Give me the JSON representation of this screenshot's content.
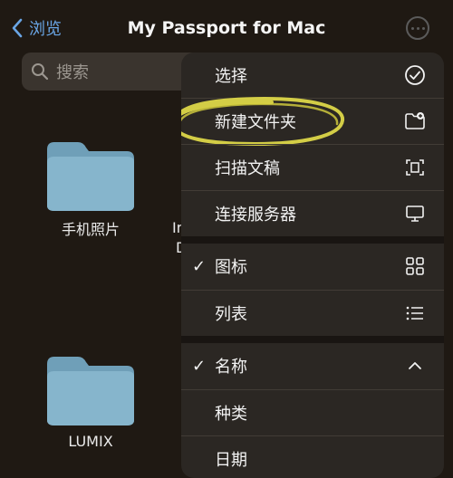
{
  "header": {
    "back_label": "浏览",
    "title": "My Passport for Mac"
  },
  "search": {
    "placeholder": "搜索"
  },
  "folders": [
    {
      "name": "手机照片"
    },
    {
      "name": "LUMIX"
    }
  ],
  "partial_labels": [
    "In",
    "D"
  ],
  "menu": {
    "items": [
      {
        "label": "选择",
        "icon": "checkmark-circle-icon",
        "checked": false
      },
      {
        "label": "新建文件夹",
        "icon": "new-folder-icon",
        "checked": false,
        "highlighted": true
      },
      {
        "label": "扫描文稿",
        "icon": "scan-document-icon",
        "checked": false
      },
      {
        "label": "连接服务器",
        "icon": "monitor-icon",
        "checked": false
      },
      {
        "label": "图标",
        "icon": "grid-icon",
        "checked": true,
        "check_mark": "✓"
      },
      {
        "label": "列表",
        "icon": "list-icon",
        "checked": false
      },
      {
        "label": "名称",
        "icon": "chevron-up-icon",
        "checked": true,
        "check_mark": "✓"
      },
      {
        "label": "种类",
        "checked": false
      },
      {
        "label": "日期",
        "checked": false
      }
    ]
  },
  "colors": {
    "background": "#1f1913",
    "menu": "#2b2723",
    "accent": "#6aa6e6",
    "folder": "#7fb0c9",
    "highlight": "#e6e04a"
  }
}
